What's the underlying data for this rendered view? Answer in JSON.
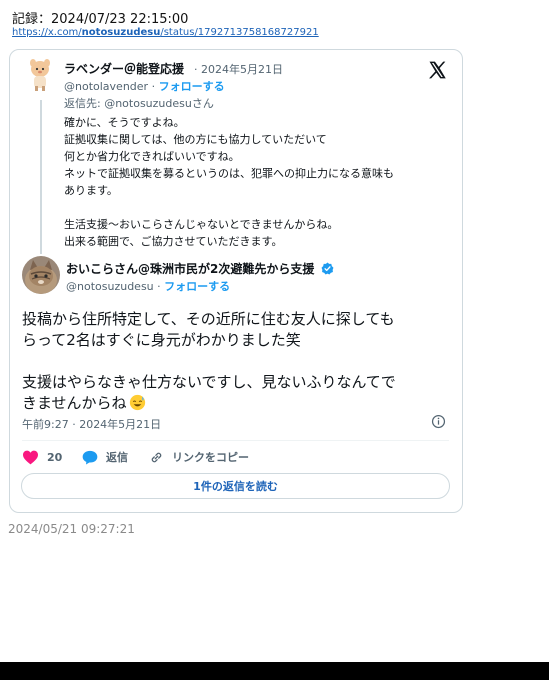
{
  "record": {
    "label": "記録：2024/07/23 22:15:00",
    "url_prefix": "https://x.com/",
    "url_user": "notosuzudesu",
    "url_suffix": "/status/1792713758168727921"
  },
  "parent_tweet": {
    "display_name": "ラベンダー＠能登応援",
    "date": "· 2024年5月21日",
    "handle": "@notolavender",
    "follow": "フォローする",
    "reply_to": "返信先: @notosuzudesuさん",
    "body_lines": [
      "確かに、そうですよね。",
      "証拠収集に関しては、他の方にも協力していただいて",
      "何とか省力化できればいいですね。",
      "ネットで証拠収集を募るというのは、犯罪への抑止力になる意味も",
      "あります。",
      "",
      "生活支援〜おいこらさんじゃないとできませんからね。",
      "出来る範囲で、ご協力させていただきます。"
    ]
  },
  "main_tweet": {
    "display_name": "おいこらさん@珠洲市民が2次避難先から支援",
    "handle": "@notosuzudesu",
    "follow": "フォローする",
    "body_lines": [
      "投稿から住所特定して、その近所に住む友人に探しても",
      "らって2名はすぐに身元がわかりました笑",
      "",
      "支援はやらなきゃ仕方ないですし、見ないふりなんてで",
      "きませんからね"
    ],
    "emoji": "sweat-smile-emoji",
    "timestamp": "午前9:27 · 2024年5月21日",
    "likes": "20",
    "reply_label": "返信",
    "copy_link_label": "リンクをコピー",
    "read_replies": "1件の返信を読む"
  },
  "capture_date": "2024/05/21 09:27:21",
  "colors": {
    "accent": "#1d9bf0",
    "link": "#1d63b8",
    "like": "#f91880",
    "verified": "#1d9bf0"
  }
}
